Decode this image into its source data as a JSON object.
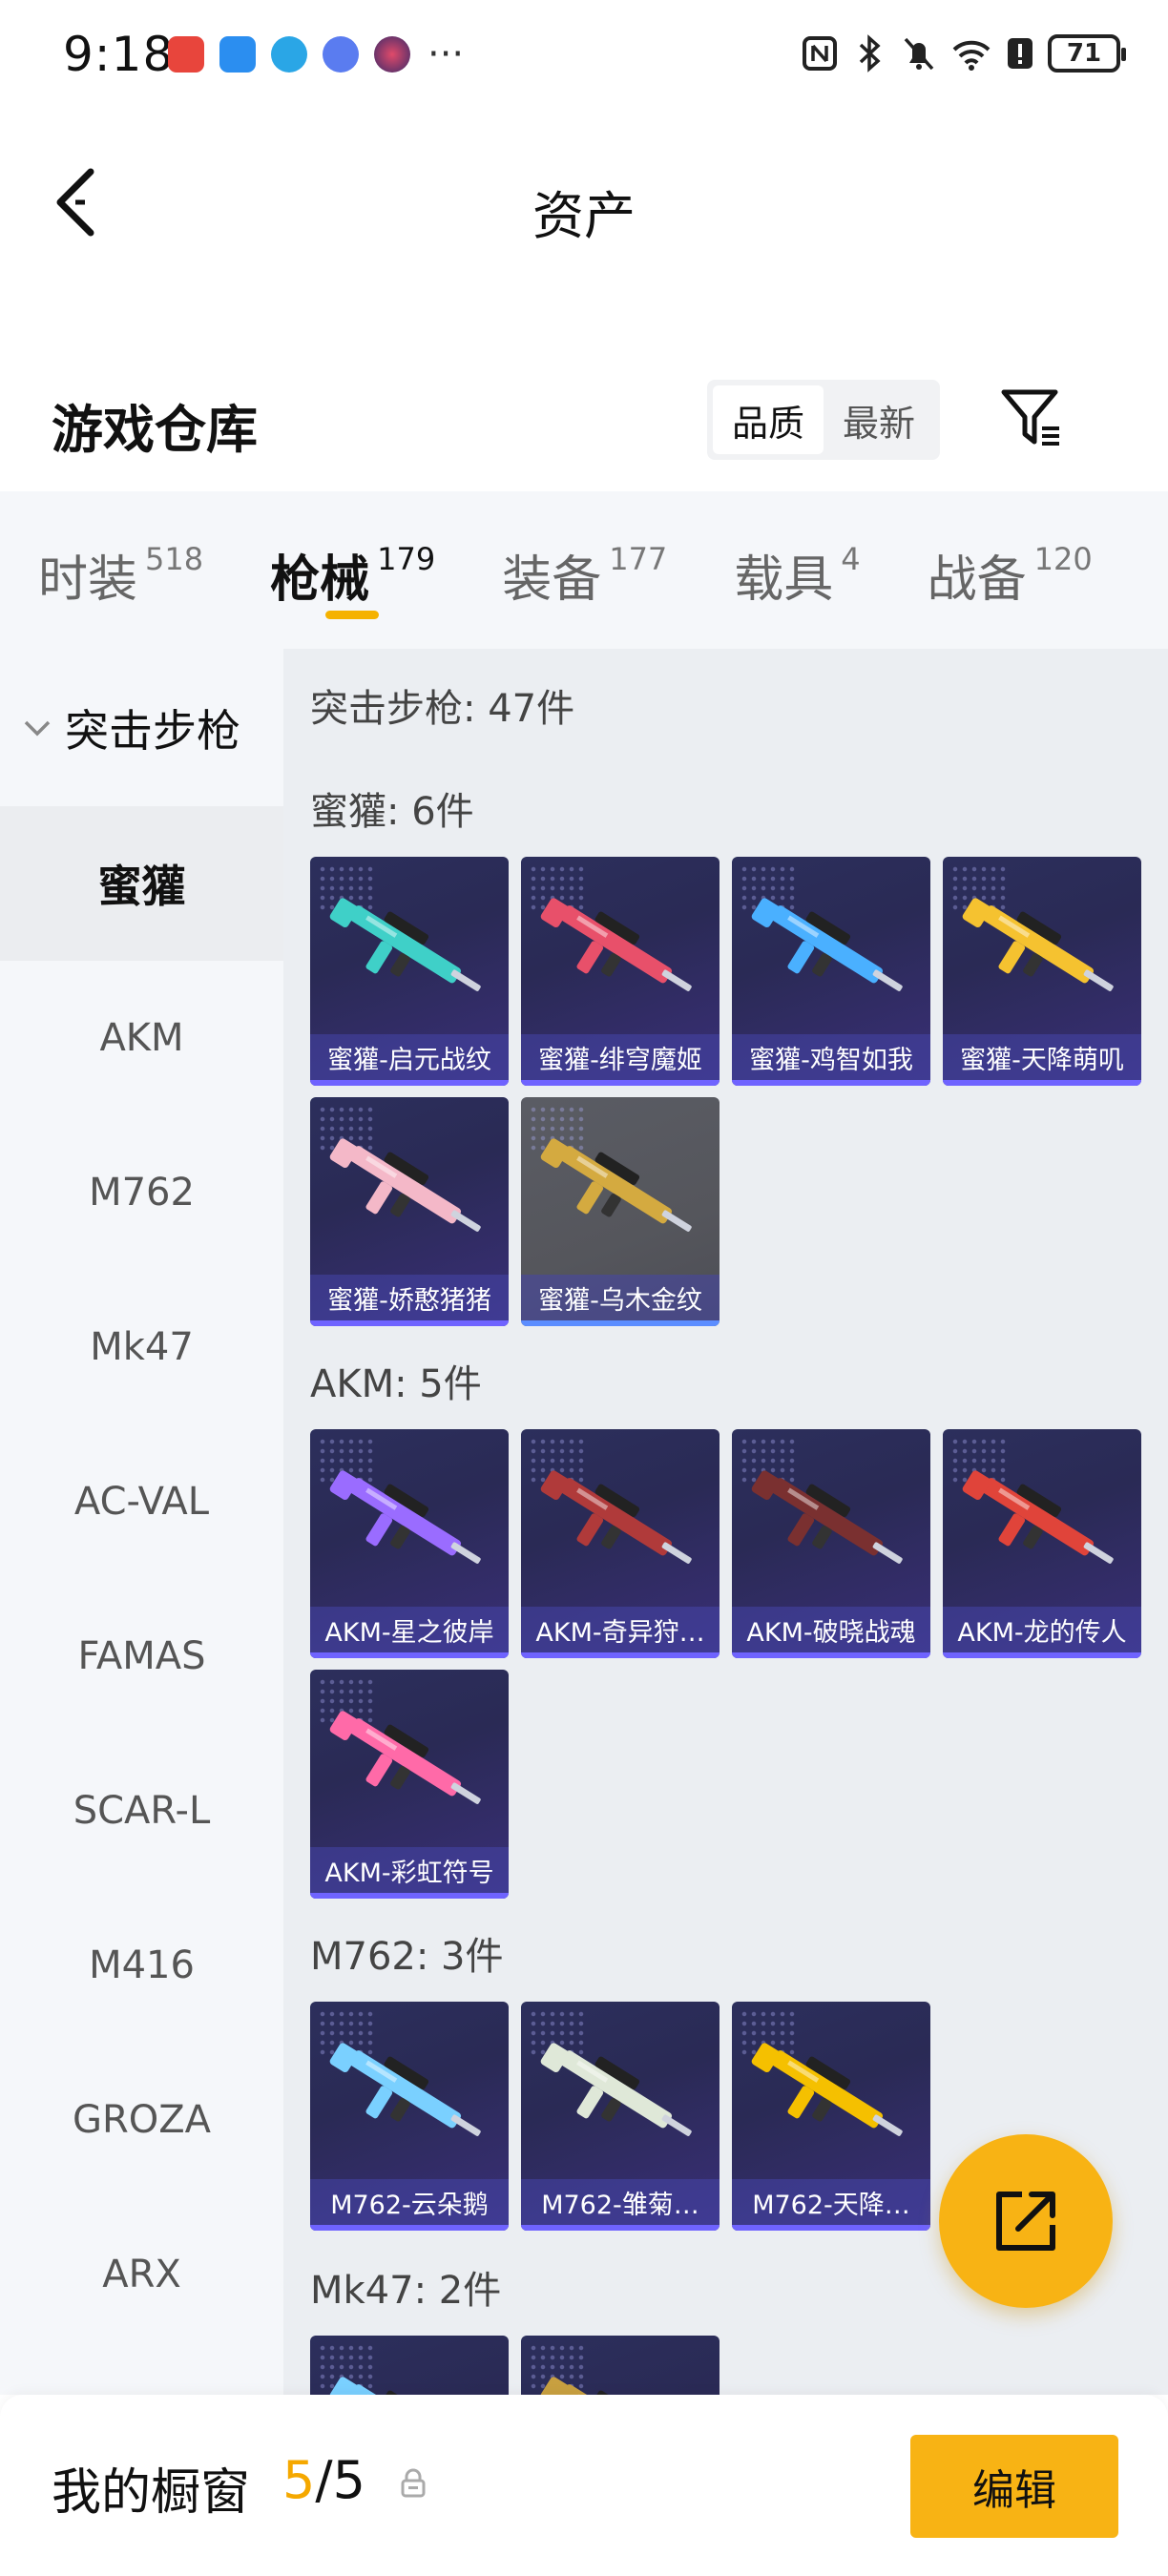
{
  "status_bar": {
    "time": "9:18",
    "battery": "71",
    "app_icons": [
      "huawei-store-icon",
      "app-icon-blue",
      "browser-icon",
      "music-icon",
      "game-avatar-icon"
    ],
    "more": "···"
  },
  "header": {
    "title": "资产",
    "back_icon": "chevron-left-icon"
  },
  "section": {
    "title": "游戏仓库",
    "sort_options": [
      "品质",
      "最新"
    ],
    "sort_active": "品质",
    "filter_icon": "filter-list-icon"
  },
  "tabs": [
    {
      "label": "时装",
      "count": "518"
    },
    {
      "label": "枪械",
      "count": "179",
      "active": true
    },
    {
      "label": "装备",
      "count": "177"
    },
    {
      "label": "载具",
      "count": "4"
    },
    {
      "label": "战备",
      "count": "120"
    }
  ],
  "sidenav": {
    "header": "突击步枪",
    "items": [
      "蜜獾",
      "AKM",
      "M762",
      "Mk47",
      "AC-VAL",
      "FAMAS",
      "SCAR-L",
      "M416",
      "GROZA",
      "ARX"
    ],
    "active": "蜜獾"
  },
  "content": {
    "total": "突击步枪: 47件",
    "groups": [
      {
        "title": "蜜獾: 6件",
        "items": [
          {
            "name": "蜜獾-启元战纹",
            "color": "#3fd0c8"
          },
          {
            "name": "蜜獾-绯穹魔姬",
            "color": "#e8506a"
          },
          {
            "name": "蜜獾-鸡智如我",
            "color": "#4ab0ff"
          },
          {
            "name": "蜜獾-天降萌叽",
            "color": "#f5c230"
          },
          {
            "name": "蜜獾-娇憨猪猪",
            "color": "#f4b8c8"
          },
          {
            "name": "蜜獾-乌木金纹",
            "color": "#d4aa40",
            "grey": true
          }
        ]
      },
      {
        "title": "AKM: 5件",
        "items": [
          {
            "name": "AKM-星之彼岸",
            "color": "#9a6cff"
          },
          {
            "name": "AKM-奇异狩…",
            "color": "#b03a3a"
          },
          {
            "name": "AKM-破晓战魂",
            "color": "#7a3030"
          },
          {
            "name": "AKM-龙的传人",
            "color": "#e0443a"
          },
          {
            "name": "AKM-彩虹符号",
            "color": "#ff6aa8"
          }
        ]
      },
      {
        "title": "M762: 3件",
        "items": [
          {
            "name": "M762-云朵鹅",
            "color": "#7ad0ff"
          },
          {
            "name": "M762-雏菊…",
            "color": "#dfe8d8"
          },
          {
            "name": "M762-天降…",
            "color": "#f5c000"
          }
        ]
      },
      {
        "title": "Mk47: 2件",
        "items": [
          {
            "name": "",
            "color": "#7ad0ff"
          },
          {
            "name": "",
            "color": "#c8a040"
          }
        ]
      }
    ]
  },
  "fab": {
    "icon": "share-external-icon"
  },
  "bottom_bar": {
    "label": "我的橱窗",
    "count_current": "5",
    "count_sep": "/",
    "count_total": "5",
    "lock_icon": "lock-icon",
    "edit_label": "编辑"
  }
}
